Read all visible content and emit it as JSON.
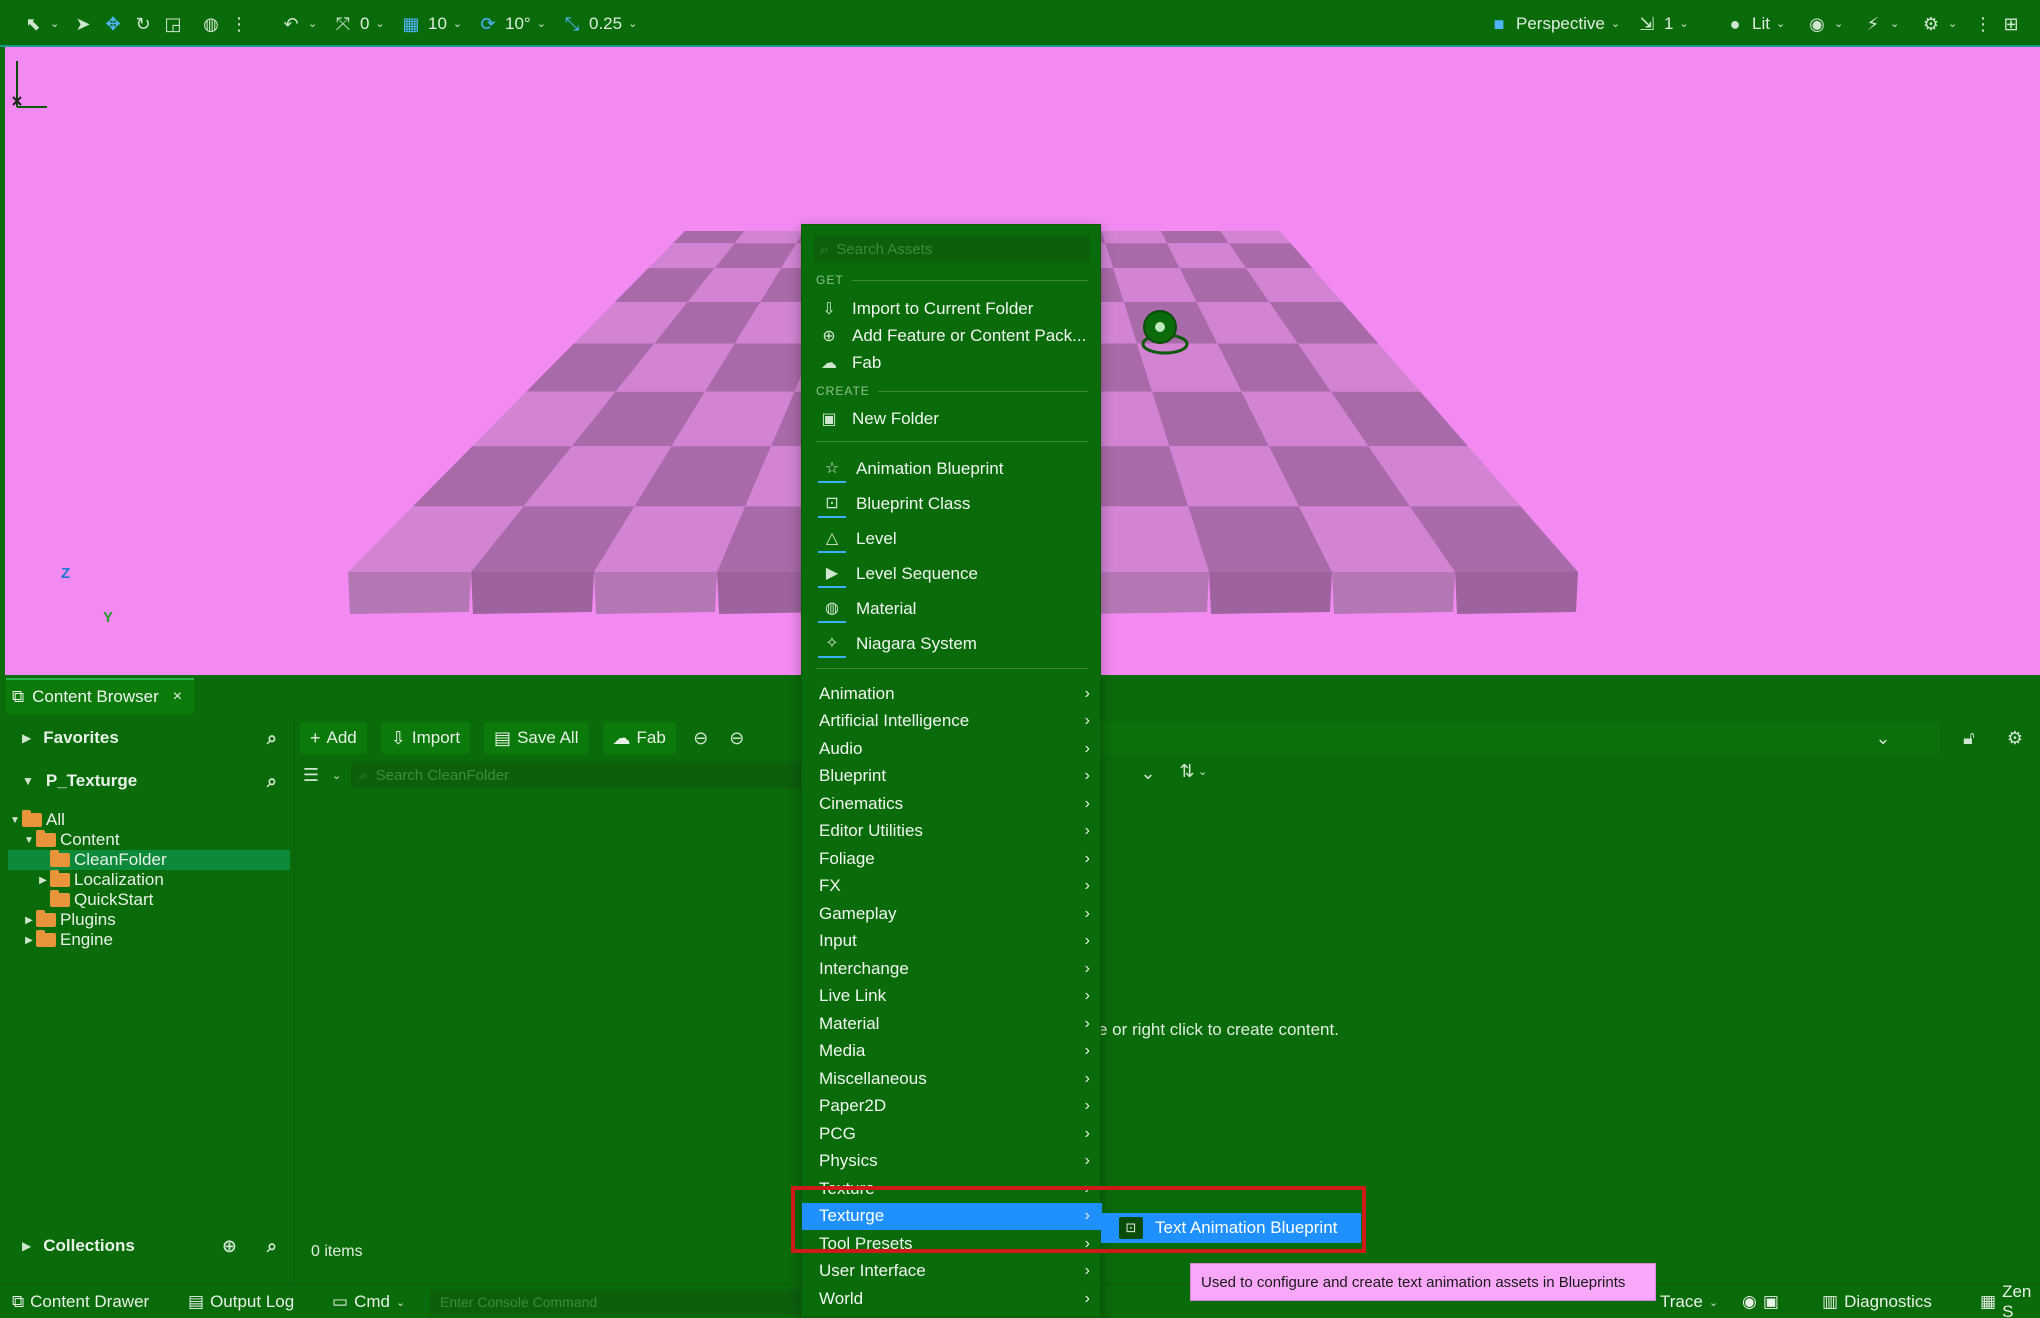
{
  "toolbar": {
    "translate_snap": "0",
    "grid_snap": "10",
    "rotation_snap": "10°",
    "scale_snap": "0.25",
    "view_mode": "Perspective",
    "camera_speed": "1",
    "lighting_mode": "Lit"
  },
  "axis": {
    "z": "Z",
    "y": "Y"
  },
  "content_browser": {
    "tab_title": "Content Browser",
    "close_glyph": "×",
    "favorites": "Favorites",
    "project": "P_Texturge",
    "collections": "Collections",
    "tree": [
      {
        "label": "All"
      },
      {
        "label": "Content"
      },
      {
        "label": "CleanFolder"
      },
      {
        "label": "Localization"
      },
      {
        "label": "QuickStart"
      },
      {
        "label": "Plugins"
      },
      {
        "label": "Engine"
      }
    ],
    "add": "Add",
    "import": "Import",
    "save_all": "Save All",
    "fab": "Fab",
    "search_placeholder": "Search CleanFolder",
    "empty_message": "e or right click to create content.",
    "items_count": "0 items"
  },
  "status_bar": {
    "content_drawer": "Content Drawer",
    "output_log": "Output Log",
    "cmd": "Cmd",
    "console_placeholder": "Enter Console Command",
    "trace": "Trace",
    "diagnostics": "Diagnostics",
    "zen": "Zen S"
  },
  "menu": {
    "search_placeholder": "Search Assets",
    "get_header": "GET",
    "create_header": "CREATE",
    "get_items": [
      {
        "label": "Import to Current Folder",
        "icon": "import-icon"
      },
      {
        "label": "Add Feature or Content Pack...",
        "icon": "content-pack-icon"
      },
      {
        "label": "Fab",
        "icon": "fab-icon"
      }
    ],
    "new_folder": "New Folder",
    "asset_items": [
      {
        "label": "Animation Blueprint"
      },
      {
        "label": "Blueprint Class"
      },
      {
        "label": "Level"
      },
      {
        "label": "Level Sequence"
      },
      {
        "label": "Material"
      },
      {
        "label": "Niagara System"
      }
    ],
    "categories": [
      "Animation",
      "Artificial Intelligence",
      "Audio",
      "Blueprint",
      "Cinematics",
      "Editor Utilities",
      "Foliage",
      "FX",
      "Gameplay",
      "Input",
      "Interchange",
      "Live Link",
      "Material",
      "Media",
      "Miscellaneous",
      "Paper2D",
      "PCG",
      "Physics",
      "Texture",
      "Texturge",
      "Tool Presets",
      "User Interface",
      "World"
    ],
    "highlighted_category": "Texturge",
    "highlight_color": "#1e90ff"
  },
  "submenu": {
    "label": "Text Animation Blueprint"
  },
  "tooltip": {
    "text": "Used to configure and create text animation assets in Blueprints"
  },
  "colors": {
    "ui_background": "#0a6b0a",
    "viewport_background": "#f28af2",
    "annotation_box": "#d01a1a"
  }
}
